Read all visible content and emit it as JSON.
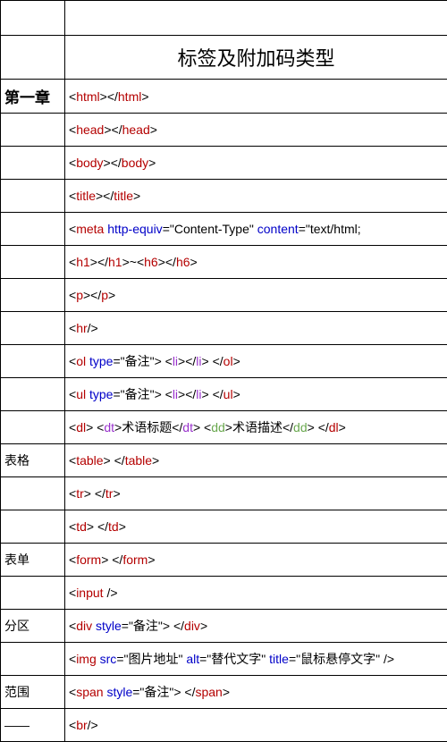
{
  "title": "标签及附加码类型",
  "chapter": "第一章",
  "labels": {
    "table": "表格",
    "form": "表单",
    "div": "分区",
    "span": "范围",
    "dash": "——"
  },
  "rows": {
    "r0": [
      {
        "t": "<",
        "c": "blk"
      },
      {
        "t": "html",
        "c": "red"
      },
      {
        "t": "></",
        "c": "blk"
      },
      {
        "t": "html",
        "c": "red"
      },
      {
        "t": ">",
        "c": "blk"
      }
    ],
    "r1": [
      {
        "t": "<",
        "c": "blk"
      },
      {
        "t": "head",
        "c": "red"
      },
      {
        "t": "></",
        "c": "blk"
      },
      {
        "t": "head",
        "c": "red"
      },
      {
        "t": ">",
        "c": "blk"
      }
    ],
    "r2": [
      {
        "t": "<",
        "c": "blk"
      },
      {
        "t": "body",
        "c": "red"
      },
      {
        "t": "></",
        "c": "blk"
      },
      {
        "t": "body",
        "c": "red"
      },
      {
        "t": ">",
        "c": "blk"
      }
    ],
    "r3": [
      {
        "t": "<",
        "c": "blk"
      },
      {
        "t": "title",
        "c": "red"
      },
      {
        "t": "></",
        "c": "blk"
      },
      {
        "t": "title",
        "c": "red"
      },
      {
        "t": ">",
        "c": "blk"
      }
    ],
    "r4": [
      {
        "t": "<",
        "c": "blk"
      },
      {
        "t": "meta ",
        "c": "red"
      },
      {
        "t": "http-equiv",
        "c": "blue"
      },
      {
        "t": "=\"Content-Type\" ",
        "c": "blk"
      },
      {
        "t": "content",
        "c": "blue"
      },
      {
        "t": "=\"text/html;",
        "c": "blk"
      }
    ],
    "r5": [
      {
        "t": "<",
        "c": "blk"
      },
      {
        "t": "h1",
        "c": "red"
      },
      {
        "t": "></",
        "c": "blk"
      },
      {
        "t": "h1",
        "c": "red"
      },
      {
        "t": ">~<",
        "c": "blk"
      },
      {
        "t": "h6",
        "c": "red"
      },
      {
        "t": "></",
        "c": "blk"
      },
      {
        "t": "h6",
        "c": "red"
      },
      {
        "t": ">",
        "c": "blk"
      }
    ],
    "r6": [
      {
        "t": "<",
        "c": "blk"
      },
      {
        "t": "p",
        "c": "red"
      },
      {
        "t": "></",
        "c": "blk"
      },
      {
        "t": "p",
        "c": "red"
      },
      {
        "t": ">",
        "c": "blk"
      }
    ],
    "r7": [
      {
        "t": "<",
        "c": "blk"
      },
      {
        "t": "hr",
        "c": "red"
      },
      {
        "t": "/>",
        "c": "blk"
      }
    ],
    "r8": [
      {
        "t": "<",
        "c": "blk"
      },
      {
        "t": "ol ",
        "c": "red"
      },
      {
        "t": "type",
        "c": "blue"
      },
      {
        "t": "=\"备注\"> <",
        "c": "blk"
      },
      {
        "t": "li",
        "c": "pur"
      },
      {
        "t": "></",
        "c": "blk"
      },
      {
        "t": "li",
        "c": "pur"
      },
      {
        "t": "> </",
        "c": "blk"
      },
      {
        "t": "ol",
        "c": "red"
      },
      {
        "t": ">",
        "c": "blk"
      }
    ],
    "r9": [
      {
        "t": "<",
        "c": "blk"
      },
      {
        "t": "ul ",
        "c": "red"
      },
      {
        "t": "type",
        "c": "blue"
      },
      {
        "t": "=\"备注\"> <",
        "c": "blk"
      },
      {
        "t": "li",
        "c": "pur"
      },
      {
        "t": "></",
        "c": "blk"
      },
      {
        "t": "li",
        "c": "pur"
      },
      {
        "t": "> </",
        "c": "blk"
      },
      {
        "t": "ul",
        "c": "red"
      },
      {
        "t": ">",
        "c": "blk"
      }
    ],
    "r10": [
      {
        "t": "<",
        "c": "blk"
      },
      {
        "t": "dl",
        "c": "red"
      },
      {
        "t": "> <",
        "c": "blk"
      },
      {
        "t": "dt",
        "c": "pur"
      },
      {
        "t": ">术语标题</",
        "c": "blk"
      },
      {
        "t": "dt",
        "c": "pur"
      },
      {
        "t": "> <",
        "c": "blk"
      },
      {
        "t": "dd",
        "c": "grn"
      },
      {
        "t": ">术语描述</",
        "c": "blk"
      },
      {
        "t": "dd",
        "c": "grn"
      },
      {
        "t": "> </",
        "c": "blk"
      },
      {
        "t": "dl",
        "c": "red"
      },
      {
        "t": ">",
        "c": "blk"
      }
    ],
    "r11": [
      {
        "t": "<",
        "c": "blk"
      },
      {
        "t": "table",
        "c": "red"
      },
      {
        "t": "> </",
        "c": "blk"
      },
      {
        "t": "table",
        "c": "red"
      },
      {
        "t": ">",
        "c": "blk"
      }
    ],
    "r12": [
      {
        "t": "<",
        "c": "blk"
      },
      {
        "t": "tr",
        "c": "red"
      },
      {
        "t": "> </",
        "c": "blk"
      },
      {
        "t": "tr",
        "c": "red"
      },
      {
        "t": ">",
        "c": "blk"
      }
    ],
    "r13": [
      {
        "t": "<",
        "c": "blk"
      },
      {
        "t": "td",
        "c": "red"
      },
      {
        "t": "> </",
        "c": "blk"
      },
      {
        "t": "td",
        "c": "red"
      },
      {
        "t": ">",
        "c": "blk"
      }
    ],
    "r14": [
      {
        "t": "<",
        "c": "blk"
      },
      {
        "t": "form",
        "c": "red"
      },
      {
        "t": "> </",
        "c": "blk"
      },
      {
        "t": "form",
        "c": "red"
      },
      {
        "t": ">",
        "c": "blk"
      }
    ],
    "r15": [
      {
        "t": "<",
        "c": "blk"
      },
      {
        "t": "input ",
        "c": "red"
      },
      {
        "t": "/>",
        "c": "blk"
      }
    ],
    "r16": [
      {
        "t": "<",
        "c": "blk"
      },
      {
        "t": "div ",
        "c": "red"
      },
      {
        "t": "style",
        "c": "blue"
      },
      {
        "t": "=\"备注\"> </",
        "c": "blk"
      },
      {
        "t": "div",
        "c": "red"
      },
      {
        "t": ">",
        "c": "blk"
      }
    ],
    "r17": [
      {
        "t": "<",
        "c": "blk"
      },
      {
        "t": "img ",
        "c": "red"
      },
      {
        "t": "src",
        "c": "blue"
      },
      {
        "t": "=\"图片地址\" ",
        "c": "blk"
      },
      {
        "t": "alt",
        "c": "blue"
      },
      {
        "t": "=\"替代文字\" ",
        "c": "blk"
      },
      {
        "t": "title",
        "c": "blue"
      },
      {
        "t": "=\"鼠标悬停文字\" />",
        "c": "blk"
      }
    ],
    "r18": [
      {
        "t": "<",
        "c": "blk"
      },
      {
        "t": "span ",
        "c": "red"
      },
      {
        "t": "style",
        "c": "blue"
      },
      {
        "t": "=\"备注\"> </",
        "c": "blk"
      },
      {
        "t": "span",
        "c": "red"
      },
      {
        "t": ">",
        "c": "blk"
      }
    ],
    "r19": [
      {
        "t": "<",
        "c": "blk"
      },
      {
        "t": "br",
        "c": "red"
      },
      {
        "t": "/>",
        "c": "blk"
      }
    ]
  }
}
